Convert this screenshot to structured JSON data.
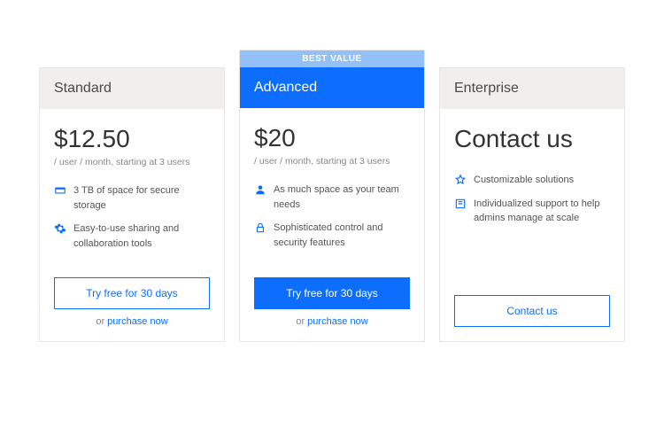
{
  "plans": [
    {
      "name": "Standard",
      "price": "$12.50",
      "price_sub": "/ user / month, starting at 3 users",
      "features": [
        {
          "icon": "storage",
          "text": "3 TB of space for secure storage"
        },
        {
          "icon": "gear",
          "text": "Easy-to-use sharing and collaboration tools"
        }
      ],
      "cta": "Try free for 30 days",
      "alt_prefix": "or ",
      "alt_link": "purchase now"
    },
    {
      "badge": "BEST VALUE",
      "name": "Advanced",
      "price": "$20",
      "price_sub": "/ user / month, starting at 3 users",
      "features": [
        {
          "icon": "person",
          "text": "As much space as your team needs"
        },
        {
          "icon": "lock",
          "text": "Sophisticated control and security features"
        }
      ],
      "cta": "Try free for 30 days",
      "alt_prefix": "or ",
      "alt_link": "purchase now"
    },
    {
      "name": "Enterprise",
      "price": "Contact us",
      "price_sub": "",
      "features": [
        {
          "icon": "star",
          "text": "Customizable solutions"
        },
        {
          "icon": "support",
          "text": "Individualized support to help admins manage at scale"
        }
      ],
      "cta": "Contact us"
    }
  ]
}
